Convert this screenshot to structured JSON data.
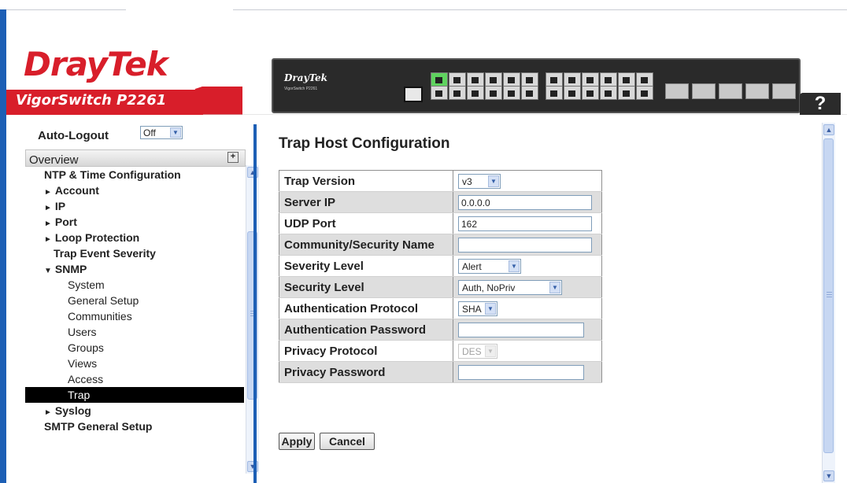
{
  "header": {
    "brand_dray": "Dray",
    "brand_tek": "Tek",
    "model": "VigorSwitch P2261",
    "help_label": "?",
    "device_brand": "DrayTek",
    "device_model": "VigorSwitch P2261"
  },
  "leftnav": {
    "auto_logout_label": "Auto-Logout",
    "auto_logout_value": "Off",
    "overview_label": "Overview",
    "items": [
      {
        "label": "NTP & Time Configuration",
        "bold": true,
        "level": "l0"
      },
      {
        "label": "Account",
        "bold": true,
        "level": "l1",
        "marker": "►"
      },
      {
        "label": "IP",
        "bold": true,
        "level": "l1",
        "marker": "►"
      },
      {
        "label": "Port",
        "bold": true,
        "level": "l1",
        "marker": "►"
      },
      {
        "label": "Loop Protection",
        "bold": true,
        "level": "l1",
        "marker": "►"
      },
      {
        "label": "Trap Event Severity",
        "bold": true,
        "level": "l1b"
      },
      {
        "label": "SNMP",
        "bold": true,
        "level": "l1",
        "marker": "▼"
      },
      {
        "label": "System",
        "bold": false,
        "level": "l2"
      },
      {
        "label": "General Setup",
        "bold": false,
        "level": "l2"
      },
      {
        "label": "Communities",
        "bold": false,
        "level": "l2"
      },
      {
        "label": "Users",
        "bold": false,
        "level": "l2"
      },
      {
        "label": "Groups",
        "bold": false,
        "level": "l2"
      },
      {
        "label": "Views",
        "bold": false,
        "level": "l2"
      },
      {
        "label": "Access",
        "bold": false,
        "level": "l2"
      },
      {
        "label": "Trap",
        "bold": false,
        "level": "l2",
        "selected": true
      },
      {
        "label": "Syslog",
        "bold": true,
        "level": "l1",
        "marker": "►"
      },
      {
        "label": "SMTP General Setup",
        "bold": true,
        "level": "l0"
      }
    ]
  },
  "main": {
    "title": "Trap Host Configuration",
    "rows": [
      {
        "label": "Trap Version",
        "type": "select",
        "value": "v3",
        "width": 54
      },
      {
        "label": "Server IP",
        "type": "input",
        "value": "0.0.0.0",
        "width": 170
      },
      {
        "label": "UDP Port",
        "type": "input",
        "value": "162",
        "width": 170
      },
      {
        "label": "Community/Security Name",
        "type": "input",
        "value": "",
        "width": 170
      },
      {
        "label": "Severity Level",
        "type": "select",
        "value": "Alert",
        "width": 80
      },
      {
        "label": "Security Level",
        "type": "select",
        "value": "Auth, NoPriv",
        "width": 132
      },
      {
        "label": "Authentication Protocol",
        "type": "select",
        "value": "SHA",
        "width": 50
      },
      {
        "label": "Authentication Password",
        "type": "input",
        "value": "",
        "width": 160
      },
      {
        "label": "Privacy Protocol",
        "type": "select",
        "value": "DES",
        "width": 50,
        "disabled": true
      },
      {
        "label": "Privacy Password",
        "type": "input",
        "value": "",
        "width": 160
      }
    ],
    "apply_label": "Apply",
    "cancel_label": "Cancel"
  },
  "colors": {
    "brand_red": "#d81e2a",
    "accent_blue": "#1d5fb5",
    "selected_bg": "#000000"
  },
  "icons": [
    "help-icon",
    "expand-plus-icon",
    "scroll-up-icon",
    "scroll-down-icon",
    "dropdown-arrow-icon"
  ]
}
